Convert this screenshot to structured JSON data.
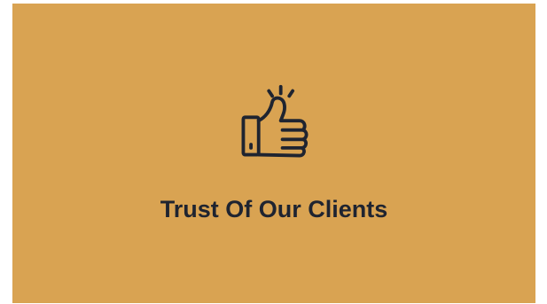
{
  "card": {
    "background_color": "#D9A352",
    "text_color": "#1F2430",
    "icon": "thumbs-up-icon",
    "title": "Trust Of Our Clients"
  }
}
